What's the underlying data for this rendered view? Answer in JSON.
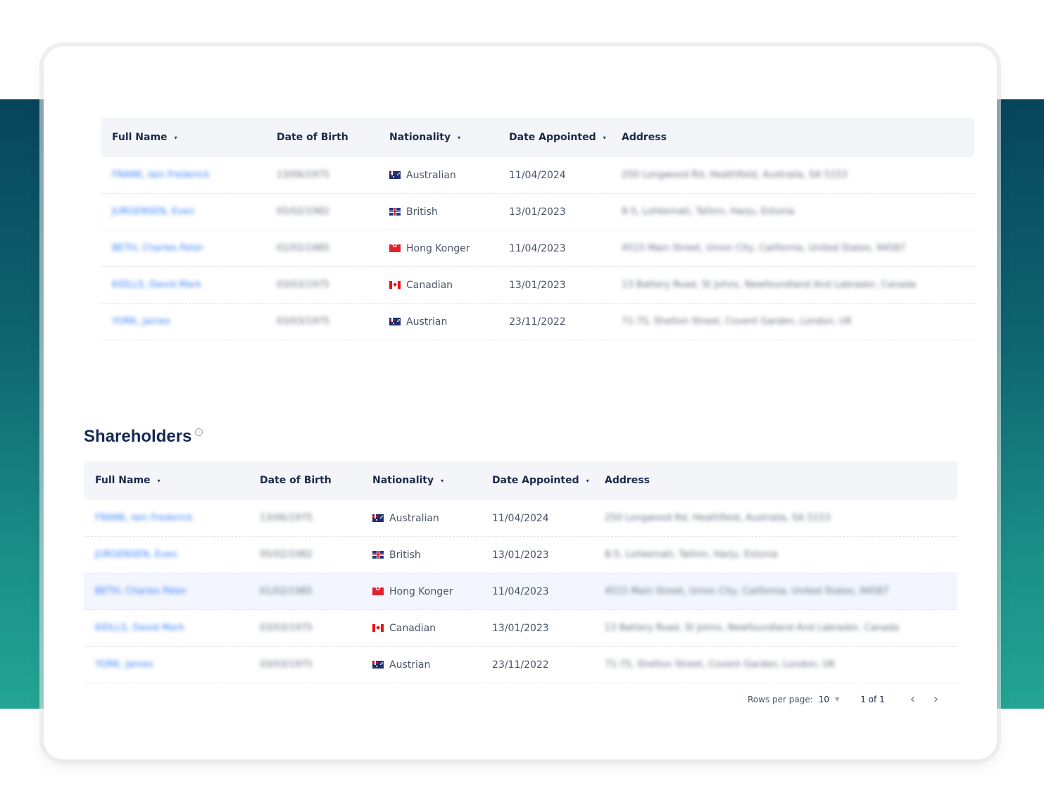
{
  "columns": {
    "full_name": "Full Name",
    "dob": "Date of Birth",
    "nationality": "Nationality",
    "date_appointed": "Date Appointed",
    "address": "Address",
    "sort_icon": "▾"
  },
  "officers": {
    "rows": [
      {
        "name": "FRANK, Iain Frederick",
        "dob": "13/06/1975",
        "flag": "au",
        "nationality": "Australian",
        "appointed": "11/04/2024",
        "address": "250 Longwood Rd, Heathfield, Australia, SA 5153"
      },
      {
        "name": "JURGENSEN, Even",
        "dob": "05/02/1982",
        "flag": "gb",
        "nationality": "British",
        "appointed": "13/01/2023",
        "address": "8-5, Lohkemati, Tallinn, Harju, Estonia"
      },
      {
        "name": "BETH, Charles Peter",
        "dob": "01/02/1985",
        "flag": "hk",
        "nationality": "Hong Konger",
        "appointed": "11/04/2023",
        "address": "4515 Main Street, Union City, California, United States, 94587"
      },
      {
        "name": "KIDLLS, David Mark",
        "dob": "03/03/1975",
        "flag": "ca",
        "nationality": "Canadian",
        "appointed": "13/01/2023",
        "address": "13 Battery Road, St Johns, Newfoundland And Labrador, Canada"
      },
      {
        "name": "YORK, James",
        "dob": "03/03/1975",
        "flag": "au",
        "nationality": "Austrian",
        "appointed": "23/11/2022",
        "address": "71-75, Shelton Street, Covent Garden, London, UK"
      }
    ]
  },
  "shareholders": {
    "title": "Shareholders",
    "info_icon": "i",
    "rows": [
      {
        "name": "FRANK, Iain Frederick",
        "dob": "13/06/1975",
        "flag": "au",
        "nationality": "Australian",
        "appointed": "11/04/2024",
        "address": "250 Longwood Rd, Heathfield, Australia, SA 5153"
      },
      {
        "name": "JURGENSEN, Even",
        "dob": "05/02/1982",
        "flag": "gb",
        "nationality": "British",
        "appointed": "13/01/2023",
        "address": "8-5, Lohkemati, Tallinn, Harju, Estonia"
      },
      {
        "name": "BETH, Charles Peter",
        "dob": "01/02/1985",
        "flag": "hk",
        "nationality": "Hong Konger",
        "appointed": "11/04/2023",
        "address": "4515 Main Street, Union City, California, United States, 94587"
      },
      {
        "name": "KIDLLS, David Mark",
        "dob": "03/03/1975",
        "flag": "ca",
        "nationality": "Canadian",
        "appointed": "13/01/2023",
        "address": "13 Battery Road, St Johns, Newfoundland And Labrador, Canada"
      },
      {
        "name": "YORK, James",
        "dob": "03/03/1975",
        "flag": "au",
        "nationality": "Austrian",
        "appointed": "23/11/2022",
        "address": "71-75, Shelton Street, Covent Garden, London, UK"
      }
    ],
    "highlighted_row": 2
  },
  "pagination": {
    "rows_per_page_label": "Rows per page:",
    "rows_per_page_value": "10",
    "dropdown_icon": "▼",
    "page_info": "1 of 1",
    "prev_icon": "‹",
    "next_icon": "›"
  },
  "colors": {
    "band_top": "#07445c",
    "band_bottom": "#23a594",
    "link": "#3b82f6",
    "heading": "#152a52"
  }
}
